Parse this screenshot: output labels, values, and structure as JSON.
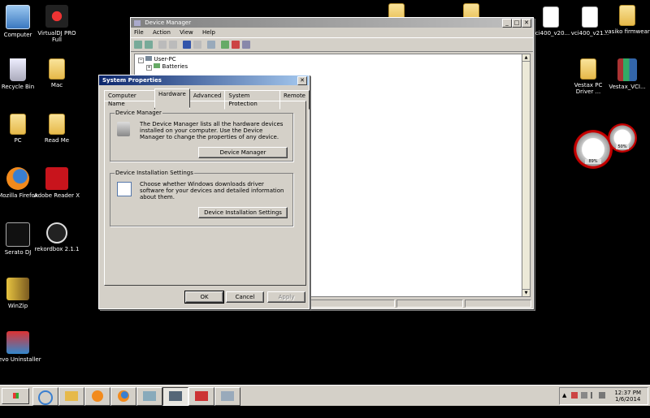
{
  "desktop": {
    "icons_left": [
      {
        "label": "Computer",
        "icon": "computer-icon"
      },
      {
        "label": "VirtualDJ PRO Full",
        "icon": "virtualdj-icon"
      },
      {
        "label": "Recycle Bin",
        "icon": "recycle-bin-icon"
      },
      {
        "label": "Mac",
        "icon": "folder-icon"
      },
      {
        "label": "PC",
        "icon": "folder-icon"
      },
      {
        "label": "Read Me",
        "icon": "folder-icon"
      },
      {
        "label": "Mozilla Firefox",
        "icon": "firefox-icon"
      },
      {
        "label": "Adobe Reader X",
        "icon": "adobe-reader-icon"
      },
      {
        "label": "Serato DJ",
        "icon": "serato-icon"
      },
      {
        "label": "rekordbox 2.1.1",
        "icon": "rekordbox-icon"
      },
      {
        "label": "WinZip",
        "icon": "winzip-icon"
      },
      {
        "label": "Revo Uninstaller",
        "icon": "revo-uninstaller-icon"
      }
    ],
    "icons_right": [
      {
        "label": "vci400_v20...",
        "icon": "document-icon"
      },
      {
        "label": "vci400_v21...",
        "icon": "document-icon"
      },
      {
        "label": "vasiko firmwear",
        "icon": "folder-icon"
      },
      {
        "label": "Vestax PC Driver ...",
        "icon": "folder-icon"
      },
      {
        "label": "Vestax_VCI...",
        "icon": "winrar-icon"
      }
    ],
    "gadget": {
      "cpu_percent": "89%",
      "memory_percent": "50%"
    }
  },
  "device_manager": {
    "title": "Device Manager",
    "menu": [
      "File",
      "Action",
      "View",
      "Help"
    ],
    "tree": {
      "root": "User-PC",
      "items": [
        "Batteries"
      ]
    }
  },
  "system_properties": {
    "title": "System Properties",
    "tabs": [
      "Computer Name",
      "Hardware",
      "Advanced",
      "System Protection",
      "Remote"
    ],
    "selected_tab": "Hardware",
    "device_manager_group": {
      "caption": "Device Manager",
      "description": "The Device Manager lists all the hardware devices installed on your computer. Use the Device Manager to change the properties of any device.",
      "button": "Device Manager"
    },
    "install_group": {
      "caption": "Device Installation Settings",
      "description": "Choose whether Windows downloads driver software for your devices and detailed information about them.",
      "button": "Device Installation Settings"
    },
    "buttons": {
      "ok": "OK",
      "cancel": "Cancel",
      "apply": "Apply"
    }
  },
  "taskbar": {
    "start_label": "Start",
    "clock_time": "12:37 PM",
    "clock_date": "1/6/2014"
  }
}
